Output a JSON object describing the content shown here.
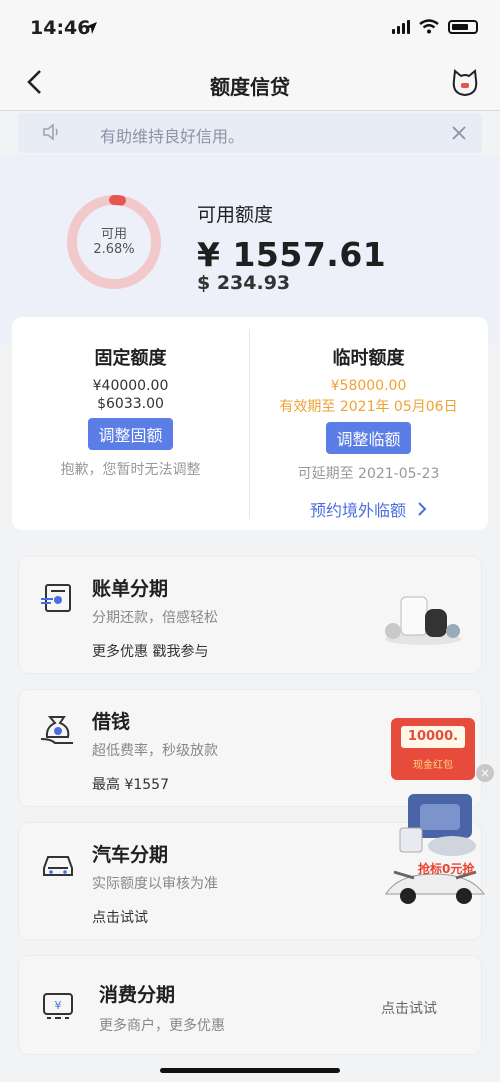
{
  "status": {
    "time": "14:46"
  },
  "nav": {
    "title": "额度信贷"
  },
  "notice": {
    "text": "有助维持良好信用。"
  },
  "credit": {
    "ring_label": "可用",
    "ring_percent": "2.68%",
    "ring_fraction": 0.0268,
    "available_label": "可用额度",
    "available_cny": "¥ 1557.61",
    "available_usd": "$ 234.93"
  },
  "fixed": {
    "title": "固定额度",
    "cny": "¥40000.00",
    "usd": "$6033.00",
    "button": "调整固额",
    "note": "抱歉，您暂时无法调整"
  },
  "temporary": {
    "title": "临时额度",
    "cny": "¥58000.00",
    "validity": "有效期至 2021年 05月06日",
    "button": "调整临额",
    "note": "可延期至 2021-05-23",
    "link": "预约境外临额"
  },
  "services": [
    {
      "title": "账单分期",
      "subtitle": "分期还款，倍感轻松",
      "extra": "更多优惠 戳我参与"
    },
    {
      "title": "借钱",
      "subtitle": "超低费率，秒级放款",
      "extra": "最高 ¥1557"
    },
    {
      "title": "汽车分期",
      "subtitle": "实际额度以审核为准",
      "extra": "点击试试"
    },
    {
      "title": "消费分期",
      "subtitle": "更多商户，更多优惠",
      "extra": "点击试试"
    }
  ],
  "promo": {
    "red_envelope_amount": "10000.",
    "red_envelope_label": "现金红包",
    "banner_text": "抢标0元抢"
  },
  "colors": {
    "accent": "#5b7de6",
    "orange": "#f0a236",
    "ring_track": "#f2c9ca",
    "ring_fill": "#e5564f"
  }
}
